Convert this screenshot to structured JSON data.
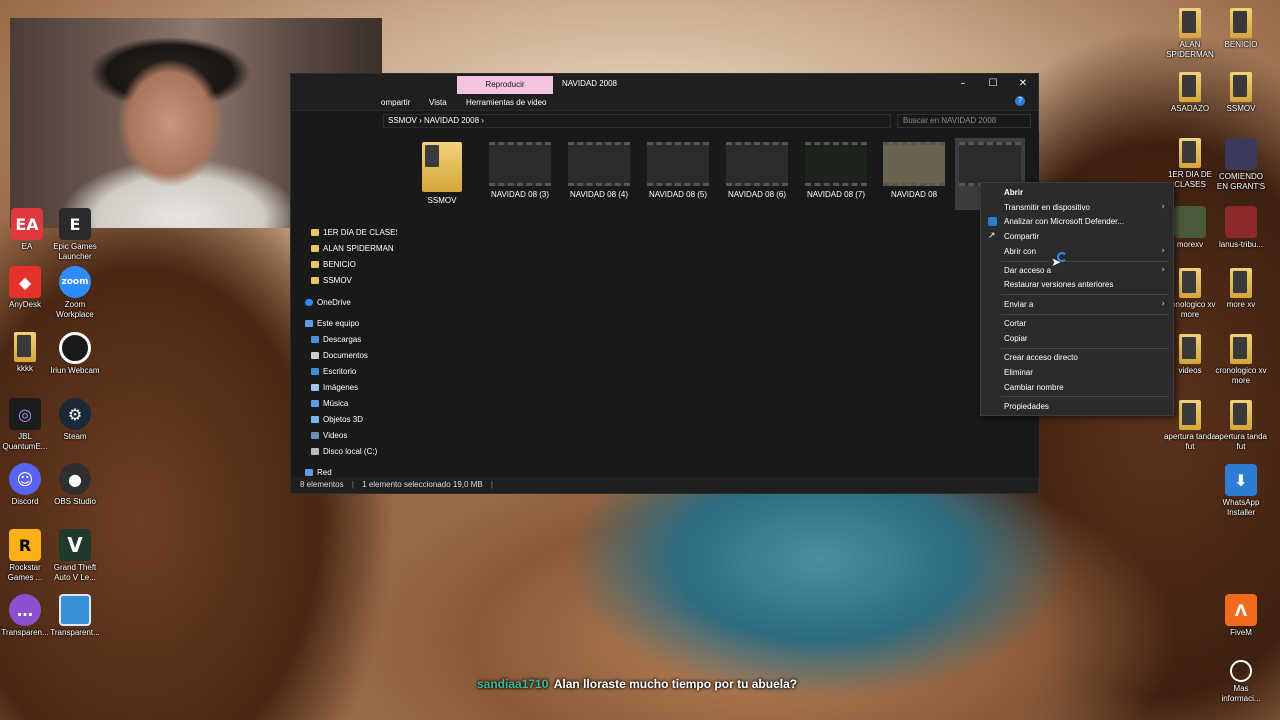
{
  "desktop_left": [
    {
      "label": "EA",
      "color": "#e0383e",
      "icon": "ea-icon"
    },
    {
      "label": "Epic Games Launcher",
      "color": "#2a2a2a",
      "icon": "epic-games-icon"
    },
    {
      "label": "AnyDesk",
      "color": "#e5322d",
      "icon": "anydesk-icon"
    },
    {
      "label": "Zoom Workplace",
      "color": "#2d8cff",
      "icon": "zoom-icon"
    },
    {
      "label": "kkkk",
      "color": "#f1d27a",
      "icon": "folder-icon"
    },
    {
      "label": "Iriun Webcam",
      "color": "#1a1a1a",
      "icon": "iriun-icon"
    },
    {
      "label": "JBL QuantumE...",
      "color": "#1c1c1c",
      "icon": "jbl-icon"
    },
    {
      "label": "Steam",
      "color": "#1b2838",
      "icon": "steam-icon"
    },
    {
      "label": "Discord",
      "color": "#5865f2",
      "icon": "discord-icon"
    },
    {
      "label": "OBS Studio",
      "color": "#302e31",
      "icon": "obs-icon"
    },
    {
      "label": "Rockstar Games ...",
      "color": "#fcaf17",
      "icon": "rockstar-icon"
    },
    {
      "label": "Grand Theft Auto V Le...",
      "color": "#1e3a2a",
      "icon": "gta-icon"
    },
    {
      "label": "Transparen...",
      "color": "#8f4fd1",
      "icon": "transparent-chat-icon"
    },
    {
      "label": "Transparent...",
      "color": "#3b8fd6",
      "icon": "transparent-window-icon"
    }
  ],
  "desktop_right": [
    {
      "label": "ALAN SPIDERMAN",
      "icon": "folder-icon"
    },
    {
      "label": "BENICIO",
      "icon": "folder-icon"
    },
    {
      "label": "ASADAZO",
      "icon": "folder-icon"
    },
    {
      "label": "SSMOV",
      "icon": "folder-icon"
    },
    {
      "label": "1ER DIA DE CLASES",
      "icon": "folder-icon"
    },
    {
      "label": "COMIENDO EN GRANT'S",
      "icon": "video-icon"
    },
    {
      "label": "morexv",
      "icon": "image-icon"
    },
    {
      "label": "lanus-tribu...",
      "icon": "image-icon"
    },
    {
      "label": "cronologico xv more",
      "icon": "folder-icon"
    },
    {
      "label": "more xv",
      "icon": "folder-icon"
    },
    {
      "label": "videos",
      "icon": "folder-icon"
    },
    {
      "label": "cronologico xv more",
      "icon": "folder-icon"
    },
    {
      "label": "apertura tanda fut",
      "icon": "folder-icon"
    },
    {
      "label": "apertura tanda fut",
      "icon": "folder-icon"
    },
    {
      "label": "WhatsApp Installer",
      "icon": "download-icon"
    },
    {
      "label": "FiveM",
      "icon": "fivem-icon"
    },
    {
      "label": "Mas informaci...",
      "icon": "info-icon"
    }
  ],
  "explorer": {
    "tab_active": "Reproducir",
    "title": "NAVIDAD 2008",
    "ribbon": [
      "ompartir",
      "Vista",
      "Herramientas de video"
    ],
    "breadcrumb": [
      "SSMOV",
      "NAVIDAD 2008"
    ],
    "search_placeholder": "Buscar en NAVIDAD 2008",
    "nav": {
      "quick": [
        "1ER DIA DE CLASES",
        "ALAN SPIDERMAN",
        "BENICIO",
        "SSMOV"
      ],
      "onedrive": "OneDrive",
      "pc": "Este equipo",
      "pc_items": [
        "Descargas",
        "Documentos",
        "Escritorio",
        "Imágenes",
        "Música",
        "Objetos 3D",
        "Videos",
        "Disco local (C:)"
      ],
      "network": "Red"
    },
    "files": [
      "SSMOV",
      "NAVIDAD 08 (3)",
      "NAVIDAD 08 (4)",
      "NAVIDAD 08 (5)",
      "NAVIDAD 08 (6)",
      "NAVIDAD 08 (7)",
      "NAVIDAD 08",
      "NA"
    ],
    "status": {
      "count": "8 elementos",
      "selected": "1 elemento seleccionado  19,0 MB"
    }
  },
  "context_menu": {
    "items": [
      "Abrir",
      "Transmitir en dispositivo",
      "Analizar con Microsoft Defender...",
      "Compartir",
      "Abrir con",
      "Dar acceso a",
      "Restaurar versiones anteriores",
      "Enviar a",
      "Cortar",
      "Copiar",
      "Crear acceso directo",
      "Eliminar",
      "Cambiar nombre",
      "Propiedades"
    ]
  },
  "chat": {
    "user": "sandiaa1710",
    "message": "Alan lloraste mucho tiempo por tu abuela?"
  }
}
